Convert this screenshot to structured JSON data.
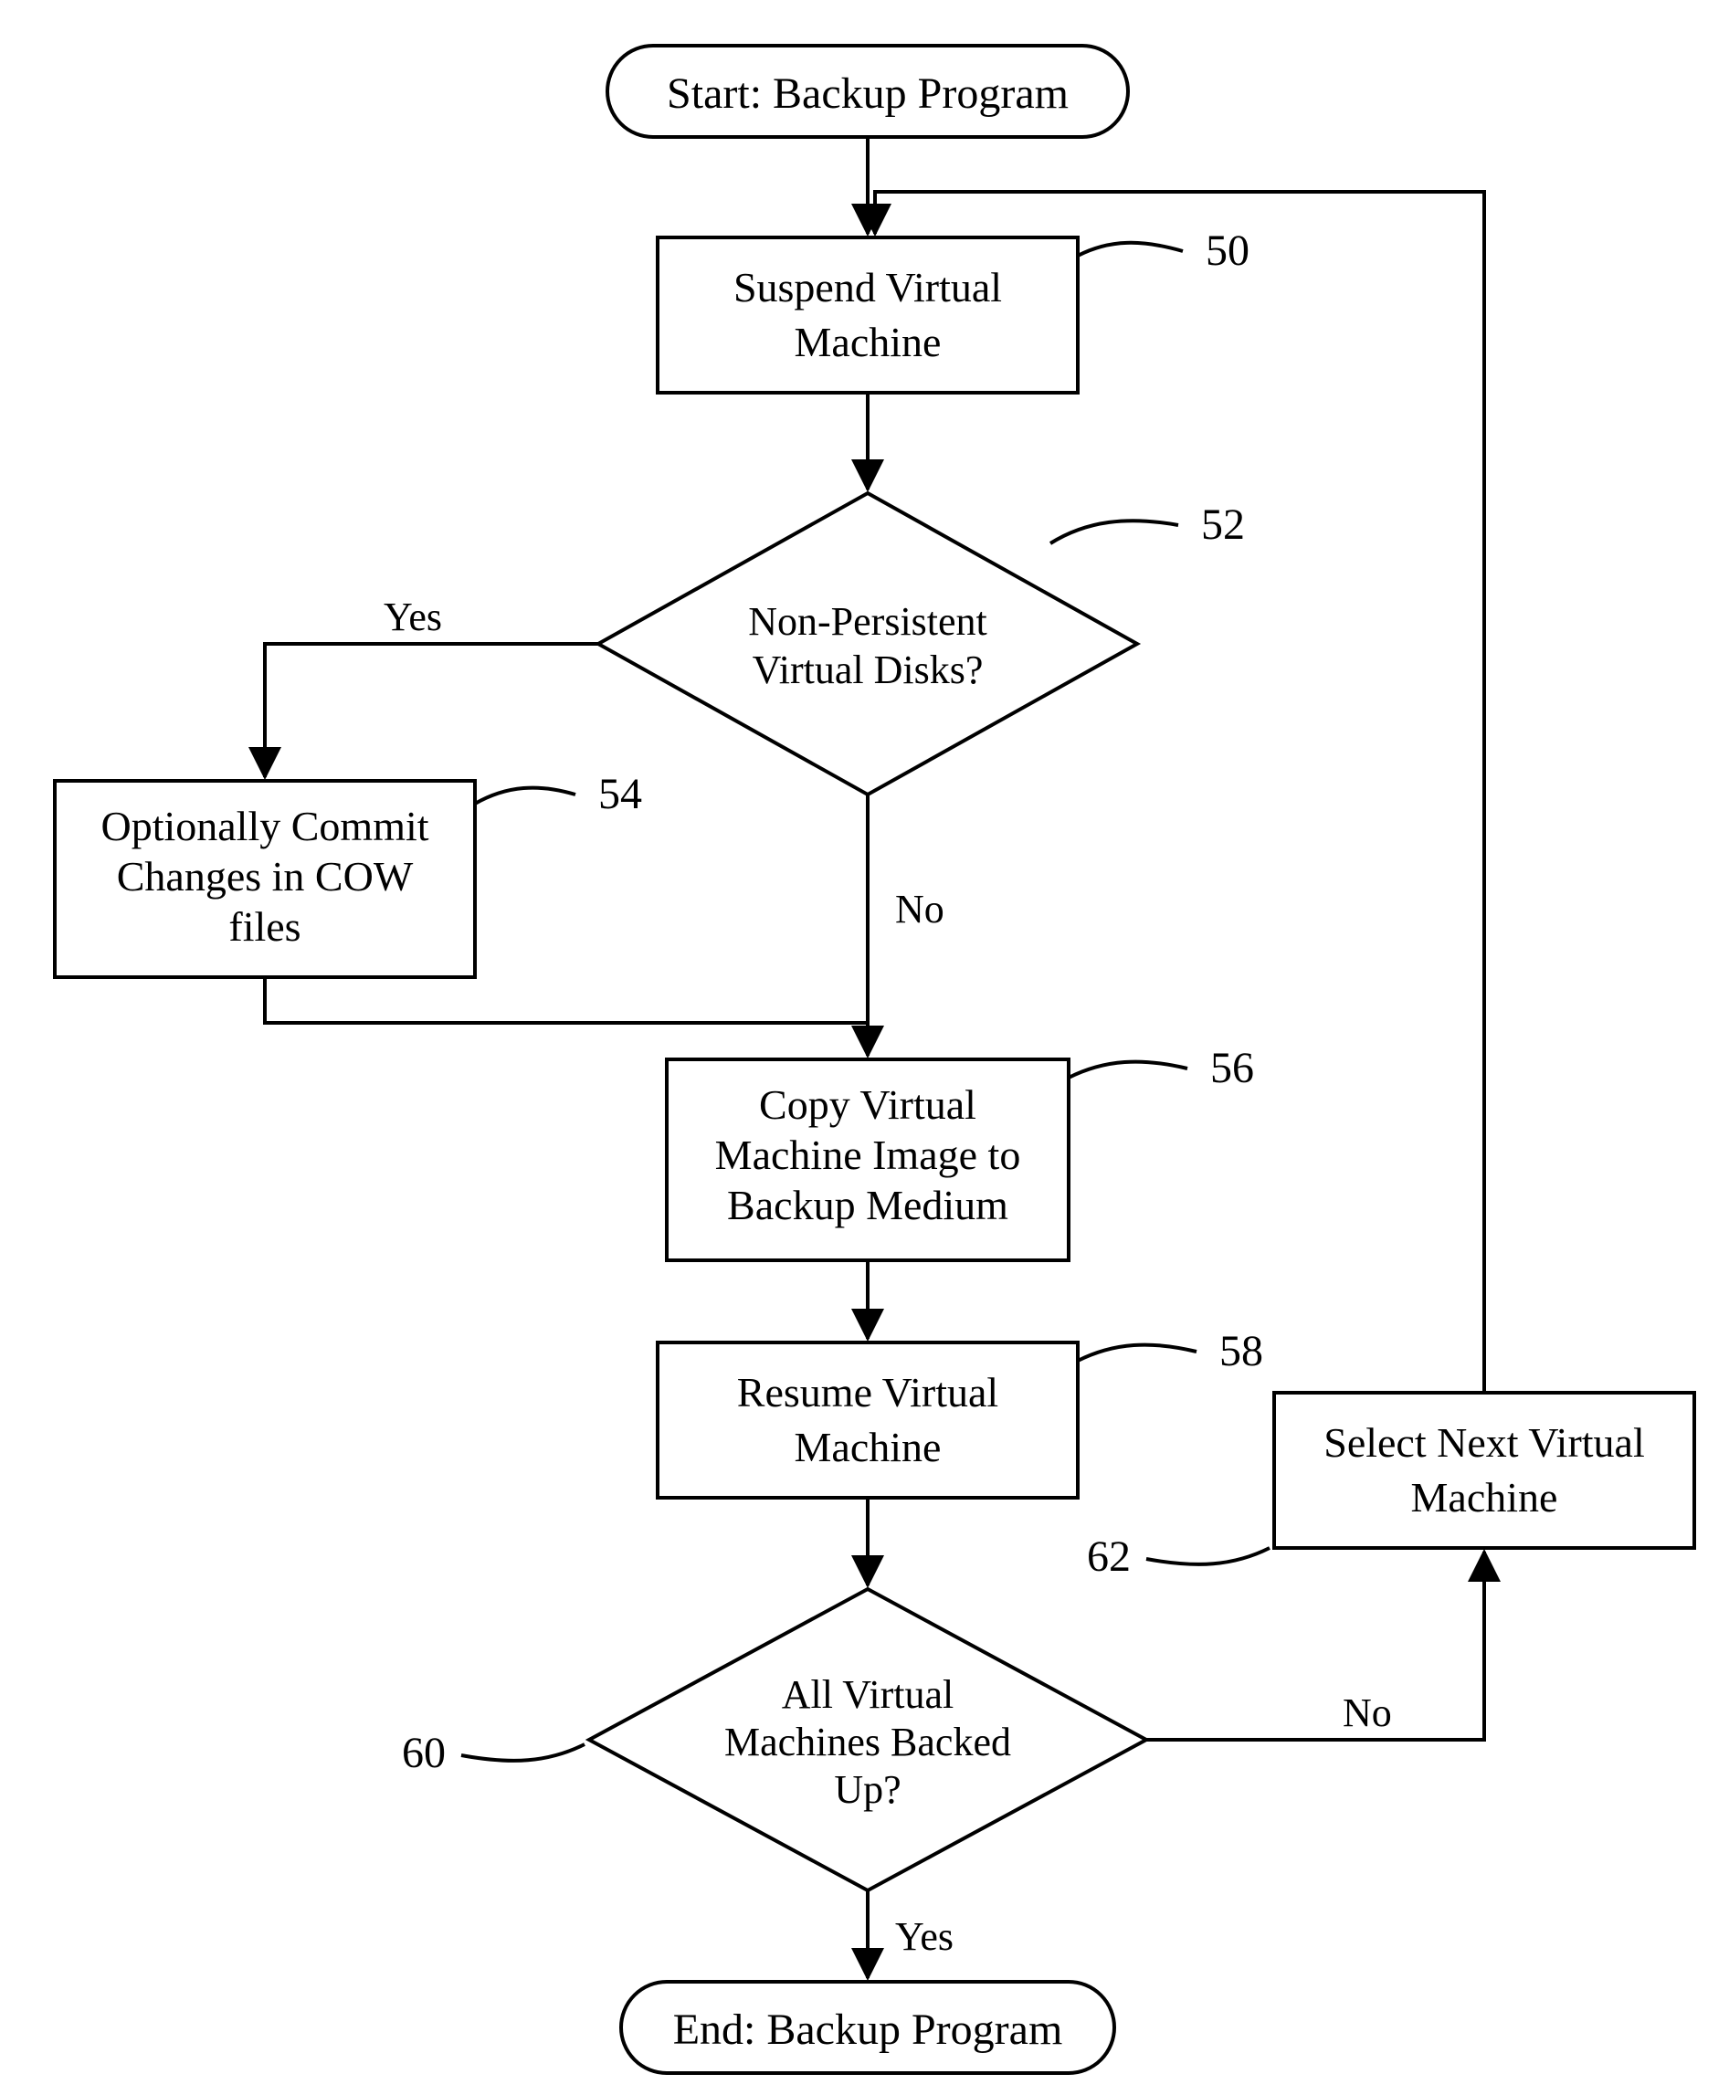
{
  "chart_data": {
    "type": "flowchart",
    "nodes": [
      {
        "id": "start",
        "type": "terminator",
        "text": "Start:  Backup Program"
      },
      {
        "id": "n50",
        "type": "process",
        "ref": "50",
        "text": "Suspend Virtual Machine"
      },
      {
        "id": "n52",
        "type": "decision",
        "ref": "52",
        "text": "Non-Persistent Virtual Disks?"
      },
      {
        "id": "n54",
        "type": "process",
        "ref": "54",
        "text": "Optionally Commit Changes in COW files"
      },
      {
        "id": "n56",
        "type": "process",
        "ref": "56",
        "text": "Copy Virtual Machine Image to Backup Medium"
      },
      {
        "id": "n58",
        "type": "process",
        "ref": "58",
        "text": "Resume Virtual Machine"
      },
      {
        "id": "n60",
        "type": "decision",
        "ref": "60",
        "text": "All Virtual Machines Backed Up?"
      },
      {
        "id": "n62",
        "type": "process",
        "ref": "62",
        "text": "Select Next Virtual Machine"
      },
      {
        "id": "end",
        "type": "terminator",
        "text": "End:  Backup Program"
      }
    ],
    "edges": [
      {
        "from": "start",
        "to": "n50"
      },
      {
        "from": "n50",
        "to": "n52"
      },
      {
        "from": "n52",
        "to": "n54",
        "label": "Yes"
      },
      {
        "from": "n52",
        "to": "n56",
        "label": "No"
      },
      {
        "from": "n54",
        "to": "n56"
      },
      {
        "from": "n56",
        "to": "n58"
      },
      {
        "from": "n58",
        "to": "n60"
      },
      {
        "from": "n60",
        "to": "end",
        "label": "Yes"
      },
      {
        "from": "n60",
        "to": "n62",
        "label": "No"
      },
      {
        "from": "n62",
        "to": "n50"
      }
    ]
  },
  "terminators": {
    "start": "Start:  Backup Program",
    "end": "End:  Backup Program"
  },
  "nodes": {
    "n50": {
      "l1": "Suspend Virtual",
      "l2": "Machine",
      "ref": "50"
    },
    "n52": {
      "l1": "Non-Persistent",
      "l2": "Virtual Disks?",
      "ref": "52"
    },
    "n54": {
      "l1": "Optionally Commit",
      "l2": "Changes in COW",
      "l3": "files",
      "ref": "54"
    },
    "n56": {
      "l1": "Copy Virtual",
      "l2": "Machine Image to",
      "l3": "Backup Medium",
      "ref": "56"
    },
    "n58": {
      "l1": "Resume Virtual",
      "l2": "Machine",
      "ref": "58"
    },
    "n60": {
      "l1": "All Virtual",
      "l2": "Machines Backed",
      "l3": "Up?",
      "ref": "60"
    },
    "n62": {
      "l1": "Select Next Virtual",
      "l2": "Machine",
      "ref": "62"
    }
  },
  "labels": {
    "yes": "Yes",
    "no": "No"
  }
}
